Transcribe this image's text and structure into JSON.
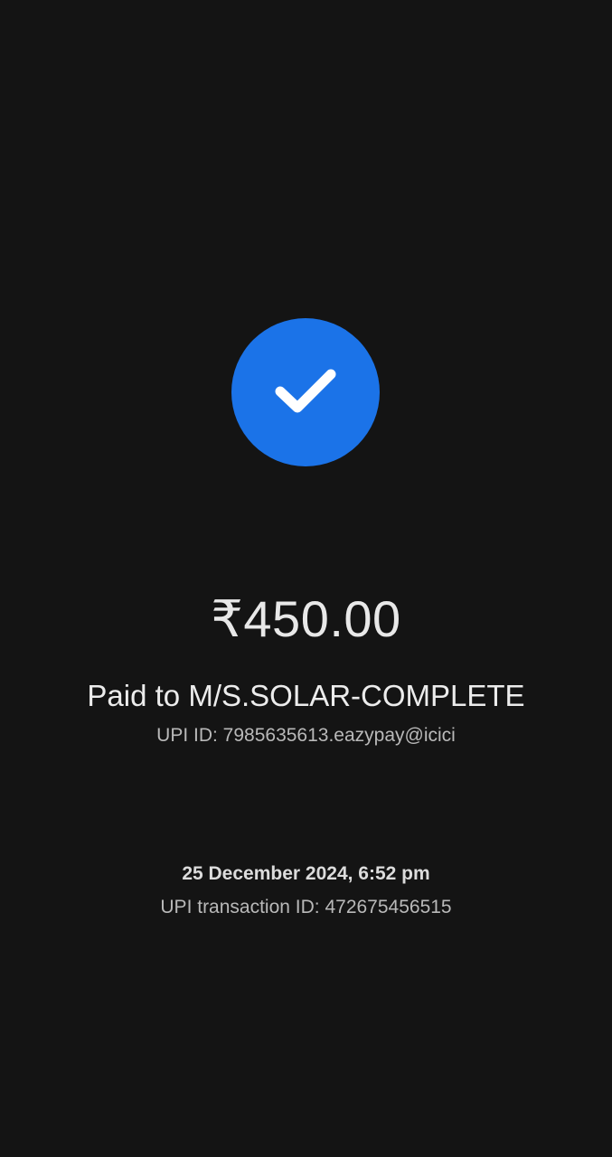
{
  "payment": {
    "status_icon": "check-icon",
    "amount": "₹450.00",
    "payee": "Paid to M/S.SOLAR-COMPLETE",
    "upi_id": "UPI ID: 7985635613.eazypay@icici",
    "datetime": "25 December 2024, 6:52 pm",
    "transaction_id": "UPI transaction ID: 472675456515"
  },
  "colors": {
    "background": "#141414",
    "accent": "#1b73e8",
    "primary_text": "#e8e8e8",
    "secondary_text": "#b9b9b9"
  }
}
